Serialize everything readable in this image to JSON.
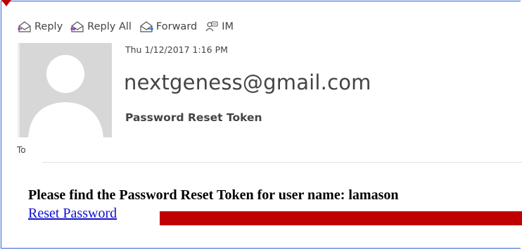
{
  "toolbar": {
    "reply_label": "Reply",
    "reply_all_label": "Reply All",
    "forward_label": "Forward",
    "im_label": "IM"
  },
  "message": {
    "date": "Thu 1/12/2017 1:16 PM",
    "sender": "nextgeness@gmail.com",
    "subject": "Password Reset Token",
    "to_label": "To",
    "body_text": "Please find the Password Reset Token for user name: lamason",
    "link_text": "Reset Password"
  },
  "colors": {
    "frame_border": "#2d62d1",
    "link": "#1010d0",
    "redaction": "#c00000",
    "pointer": "#c00000"
  },
  "icons": [
    "reply-icon",
    "reply-all-icon",
    "forward-icon",
    "im-icon",
    "avatar-placeholder"
  ]
}
